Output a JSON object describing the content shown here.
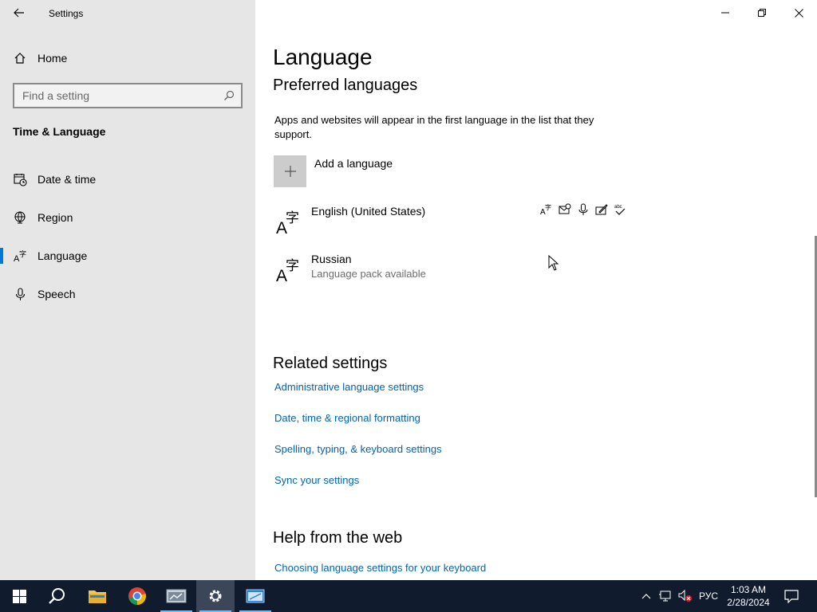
{
  "window": {
    "app_title": "Settings",
    "controls": [
      "minimize",
      "restore",
      "close"
    ]
  },
  "sidebar": {
    "home_label": "Home",
    "search": {
      "placeholder": "Find a setting",
      "value": ""
    },
    "section_title": "Time & Language",
    "items": [
      {
        "label": "Date & time",
        "icon": "date-time-icon",
        "active": false
      },
      {
        "label": "Region",
        "icon": "globe-icon",
        "active": false
      },
      {
        "label": "Language",
        "icon": "language-icon",
        "active": true
      },
      {
        "label": "Speech",
        "icon": "microphone-icon",
        "active": false
      }
    ],
    "accent_color": "#0078d7"
  },
  "main": {
    "title": "Language",
    "preferred_title": "Preferred languages",
    "description": "Apps and websites will appear in the first language in the list that they support.",
    "add_language_label": "Add a language",
    "languages": [
      {
        "name": "English (United States)",
        "status": "",
        "feature_icons": [
          "display-language-icon",
          "language-pack-icon",
          "speech-icon",
          "handwriting-icon",
          "spell-check-icon"
        ]
      },
      {
        "name": "Russian",
        "status": "Language pack available"
      }
    ],
    "related_title": "Related settings",
    "related_links": [
      "Administrative language settings",
      "Date, time & regional formatting",
      "Spelling, typing, & keyboard settings",
      "Sync your settings"
    ],
    "help_title": "Help from the web",
    "help_links": [
      "Choosing language settings for your keyboard"
    ],
    "link_color": "#0063b1"
  },
  "taskbar": {
    "apps": [
      "start-icon",
      "search-icon",
      "file-explorer-icon",
      "chrome-icon",
      "app-icon",
      "settings-icon",
      "window-app-icon"
    ],
    "active_app": "settings-icon",
    "tray": {
      "input_language": "РУС",
      "time": "1:03 AM",
      "date": "2/28/2024"
    }
  }
}
